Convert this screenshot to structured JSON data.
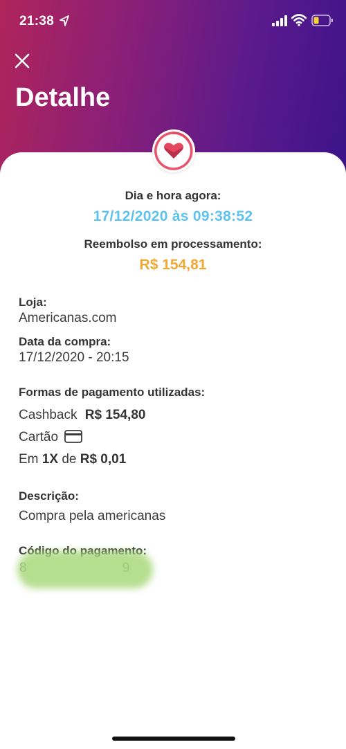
{
  "status_bar": {
    "time": "21:38",
    "icons": [
      "location-arrow-icon",
      "cellular-signal-icon",
      "wifi-icon",
      "battery-icon"
    ]
  },
  "header": {
    "title": "Detalhe",
    "close_icon": "close-icon",
    "gradient_colors": [
      "#b0245a",
      "#3d1389"
    ]
  },
  "badge": {
    "icon": "heart-icon",
    "ring_color": "#e5475f"
  },
  "datetime": {
    "label": "Dia e hora agora:",
    "value": "17/12/2020 às 09:38:52",
    "color": "#5ec2ee"
  },
  "refund": {
    "label": "Reembolso em processamento:",
    "value": "R$ 154,81",
    "color": "#f0a736"
  },
  "store": {
    "label": "Loja:",
    "value": "Americanas.com"
  },
  "purchase_date": {
    "label": "Data da compra:",
    "value": "17/12/2020 - 20:15"
  },
  "payment_methods": {
    "label": "Formas de pagamento utilizadas:",
    "cashback_label": "Cashback",
    "cashback_value": "R$ 154,80",
    "card_label": "Cartão",
    "card_icon": "credit-card-icon",
    "installments_prefix": "Em",
    "installments_count": "1X",
    "installments_mid": "de",
    "installments_value": "R$ 0,01"
  },
  "description": {
    "label": "Descrição:",
    "value": "Compra pela americanas"
  },
  "payment_code": {
    "label": "Código do pagamento:",
    "value_visible_start": "8",
    "value_visible_end": "9"
  }
}
